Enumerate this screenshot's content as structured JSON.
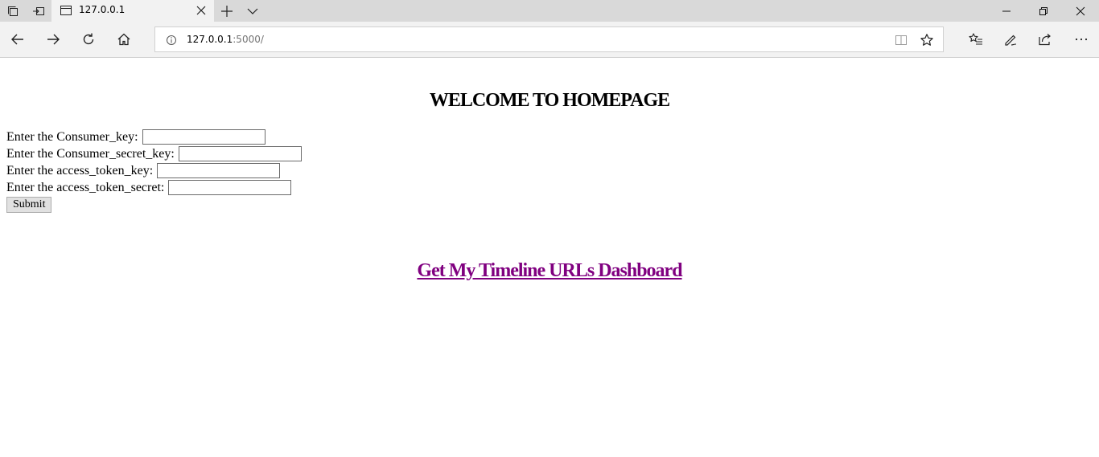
{
  "browser": {
    "tab_title": "127.0.0.1",
    "address": {
      "host": "127.0.0.1",
      "port_path": ":5000/"
    },
    "icons": {
      "tab_actions": "set-tabs-aside-icon",
      "tab_restore": "show-tabs-aside-icon",
      "favicon": "page-icon",
      "close_tab": "close-icon",
      "new_tab": "plus-icon",
      "tab_preview": "chevron-down-icon",
      "back": "arrow-left-icon",
      "forward": "arrow-right-icon",
      "refresh": "refresh-icon",
      "home": "home-icon",
      "site_info": "info-icon",
      "reading_view": "book-icon",
      "favorite": "star-icon",
      "favorites_hub": "favorites-list-icon",
      "notes": "pen-icon",
      "share": "share-icon",
      "more": "ellipsis-icon"
    }
  },
  "page": {
    "heading": "WELCOME TO HOMEPAGE",
    "form": {
      "fields": [
        {
          "label": "Enter the Consumer_key:",
          "value": ""
        },
        {
          "label": "Enter the Consumer_secret_key:",
          "value": ""
        },
        {
          "label": "Enter the access_token_key:",
          "value": ""
        },
        {
          "label": "Enter the access_token_secret:",
          "value": ""
        }
      ],
      "submit_label": "Submit"
    },
    "dashboard_link": "Get My Timeline URLs Dashboard",
    "colors": {
      "visited_link": "#800080"
    }
  }
}
